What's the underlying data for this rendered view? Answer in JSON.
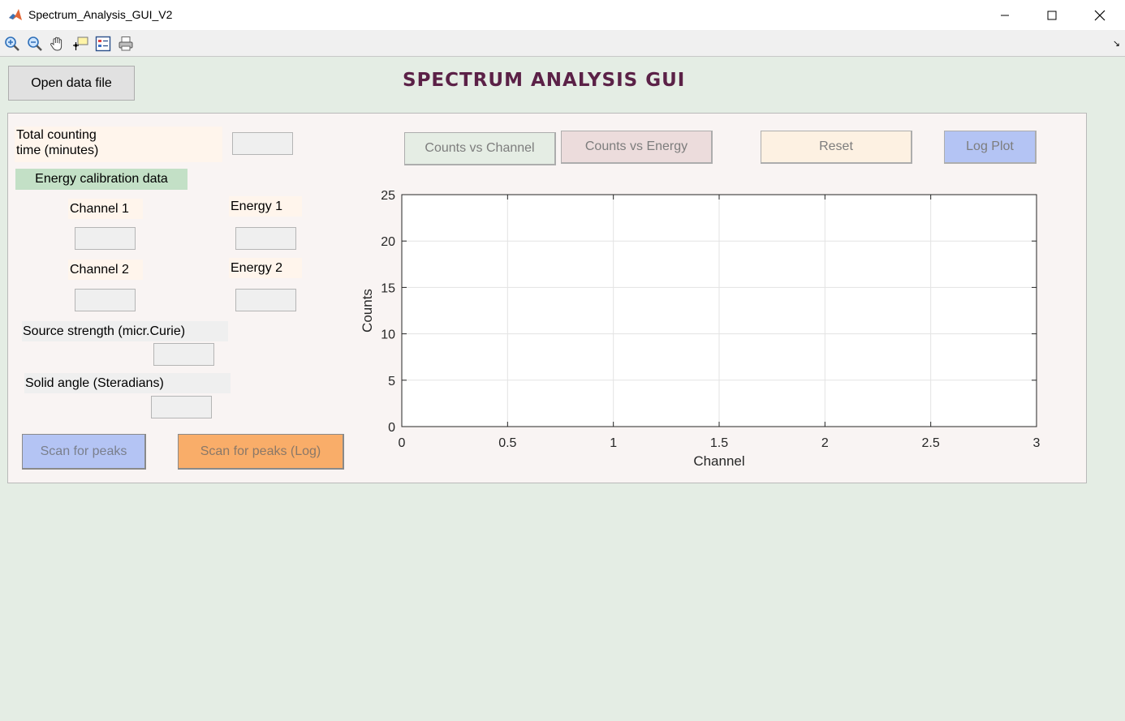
{
  "window": {
    "title": "Spectrum_Analysis_GUI_V2",
    "controls": [
      "minimize-icon",
      "maximize-icon",
      "close-icon"
    ]
  },
  "toolbar": {
    "tools": [
      "zoom-in-icon",
      "zoom-out-icon",
      "pan-hand-icon",
      "data-cursor-icon",
      "legend-icon",
      "print-icon"
    ]
  },
  "main": {
    "open_button": "Open data file",
    "app_title": "SPECTRUM ANALYSIS GUI",
    "total_time_label": "Total counting time (minutes)",
    "total_time_label_line1": "Total counting",
    "total_time_label_line2": "time (minutes)",
    "total_time_value": "",
    "calibration_label": "Energy calibration data",
    "channel1_label": "Channel 1",
    "channel1_value": "",
    "energy1_label": "Energy 1",
    "energy1_value": "",
    "channel2_label": "Channel 2",
    "channel2_value": "",
    "energy2_label": "Energy 2",
    "energy2_value": "",
    "source_strength_label": "Source strength (micr.Curie)",
    "source_strength_value": "",
    "solid_angle_label": "Solid angle (Steradians)",
    "solid_angle_value": "",
    "scan_button": "Scan for peaks",
    "scan_log_button": "Scan for peaks (Log)",
    "counts_vs_channel_button": "Counts vs Channel",
    "counts_vs_energy_button": "Counts vs Energy",
    "reset_button": "Reset",
    "log_plot_button": "Log Plot"
  },
  "colors": {
    "background": "#e4ede4",
    "panel": "#f9f4f3",
    "title": "#5b2147",
    "calibration_bg": "#c3e0c6",
    "scan_btn": "#b4c4f4",
    "scan_log_btn": "#f9ad69",
    "counts_channel_btn": "#e5ede4",
    "counts_energy_btn": "#ecdcdc",
    "reset_btn": "#fdf1e2",
    "log_plot_btn": "#b4c4f4"
  },
  "chart_data": {
    "type": "line",
    "series": [],
    "xlabel": "Channel",
    "ylabel": "Counts",
    "xlim": [
      0,
      3
    ],
    "ylim": [
      0,
      25
    ],
    "xticks": [
      "0",
      "0.5",
      "1",
      "1.5",
      "2",
      "2.5",
      "3"
    ],
    "yticks": [
      "0",
      "5",
      "10",
      "15",
      "20",
      "25"
    ],
    "grid": true
  }
}
